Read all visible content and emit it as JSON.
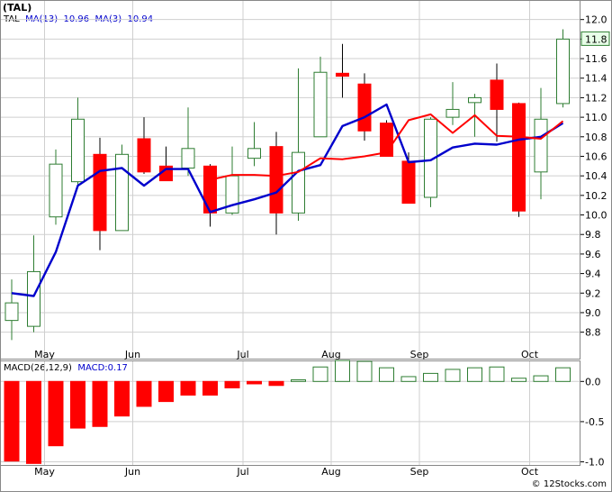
{
  "title": "(TAL)",
  "legend": {
    "ticker": "TAL",
    "ma13_label": "MA(13)",
    "ma13_value": "10.96",
    "ma3_label": "MA(3)",
    "ma3_value": "10.94",
    "macd_label": "MACD(26,12,9)",
    "macd_value_label": "MACD:0.17"
  },
  "watermark": "© 12Stocks.com",
  "chart_data": [
    {
      "type": "candlestick",
      "price_axis": {
        "ylim": [
          8.52,
          12.2
        ],
        "ticks": [
          "8.8",
          "9.0",
          "9.2",
          "9.4",
          "9.6",
          "9.8",
          "10.0",
          "10.2",
          "10.4",
          "10.6",
          "10.8",
          "11.0",
          "11.2",
          "11.4",
          "11.6",
          "11.8",
          "12.0"
        ],
        "last_price_label": "11.8"
      },
      "x_month_labels": [
        {
          "label": "May",
          "index": 1
        },
        {
          "label": "Jun",
          "index": 5
        },
        {
          "label": "Jul",
          "index": 10
        },
        {
          "label": "Aug",
          "index": 14
        },
        {
          "label": "Sep",
          "index": 18
        },
        {
          "label": "Oct",
          "index": 23
        }
      ],
      "candles": [
        {
          "o": 8.92,
          "h": 9.34,
          "l": 8.72,
          "c": 9.1
        },
        {
          "o": 8.86,
          "h": 9.79,
          "l": 8.8,
          "c": 9.42
        },
        {
          "o": 9.98,
          "h": 10.67,
          "l": 9.9,
          "c": 10.52
        },
        {
          "o": 10.34,
          "h": 11.2,
          "l": 10.28,
          "c": 10.98
        },
        {
          "o": 10.62,
          "h": 10.79,
          "l": 9.64,
          "c": 9.84
        },
        {
          "o": 9.84,
          "h": 10.72,
          "l": 9.84,
          "c": 10.62
        },
        {
          "o": 10.78,
          "h": 11.0,
          "l": 10.42,
          "c": 10.44
        },
        {
          "o": 10.5,
          "h": 10.7,
          "l": 10.35,
          "c": 10.35
        },
        {
          "o": 10.48,
          "h": 11.1,
          "l": 10.4,
          "c": 10.68
        },
        {
          "o": 10.5,
          "h": 10.52,
          "l": 9.88,
          "c": 10.02
        },
        {
          "o": 10.02,
          "h": 10.7,
          "l": 10.0,
          "c": 10.4
        },
        {
          "o": 10.58,
          "h": 10.95,
          "l": 10.5,
          "c": 10.68
        },
        {
          "o": 10.7,
          "h": 10.85,
          "l": 9.8,
          "c": 10.02
        },
        {
          "o": 10.02,
          "h": 11.5,
          "l": 9.94,
          "c": 10.64
        },
        {
          "o": 10.8,
          "h": 11.62,
          "l": 10.8,
          "c": 11.46
        },
        {
          "o": 11.45,
          "h": 11.75,
          "l": 11.2,
          "c": 11.42
        },
        {
          "o": 11.34,
          "h": 11.45,
          "l": 10.76,
          "c": 10.86
        },
        {
          "o": 10.94,
          "h": 10.97,
          "l": 10.6,
          "c": 10.6
        },
        {
          "o": 10.55,
          "h": 10.64,
          "l": 10.12,
          "c": 10.12
        },
        {
          "o": 10.18,
          "h": 11.0,
          "l": 10.08,
          "c": 10.98
        },
        {
          "o": 11.0,
          "h": 11.36,
          "l": 10.92,
          "c": 11.08
        },
        {
          "o": 11.15,
          "h": 11.24,
          "l": 10.8,
          "c": 11.2
        },
        {
          "o": 11.38,
          "h": 11.55,
          "l": 10.75,
          "c": 11.08
        },
        {
          "o": 11.14,
          "h": 11.15,
          "l": 9.98,
          "c": 10.04
        },
        {
          "o": 10.44,
          "h": 11.3,
          "l": 10.16,
          "c": 10.98
        },
        {
          "o": 11.14,
          "h": 11.9,
          "l": 11.1,
          "c": 11.8
        }
      ],
      "series": [
        {
          "name": "MA(13)",
          "color": "#0000cc",
          "values": [
            9.2,
            9.17,
            9.62,
            10.3,
            10.45,
            10.48,
            10.3,
            10.47,
            10.47,
            10.03,
            10.1,
            10.16,
            10.23,
            10.45,
            10.51,
            10.91,
            11.0,
            11.13,
            10.54,
            10.56,
            10.69,
            10.73,
            10.72,
            10.77,
            10.8,
            10.94
          ]
        },
        {
          "name": "MA(3)",
          "color": "#ff0000",
          "values": [
            null,
            null,
            null,
            null,
            null,
            null,
            null,
            null,
            null,
            10.36,
            10.41,
            10.41,
            10.4,
            10.44,
            10.58,
            10.57,
            10.6,
            10.64,
            10.97,
            11.03,
            10.84,
            11.02,
            10.81,
            10.8,
            10.78,
            10.96
          ]
        }
      ]
    },
    {
      "type": "bar",
      "name": "MACD(26,12,9)",
      "ylim": [
        -1.05,
        0.25
      ],
      "ticks": [
        "-1.0",
        "-0.5",
        "0.0"
      ],
      "values": [
        -0.99,
        -1.02,
        -0.8,
        -0.58,
        -0.56,
        -0.43,
        -0.31,
        -0.25,
        -0.17,
        -0.17,
        -0.08,
        -0.03,
        -0.05,
        0.02,
        0.18,
        0.26,
        0.25,
        0.17,
        0.06,
        0.1,
        0.15,
        0.17,
        0.18,
        0.04,
        0.07,
        0.17
      ]
    }
  ]
}
